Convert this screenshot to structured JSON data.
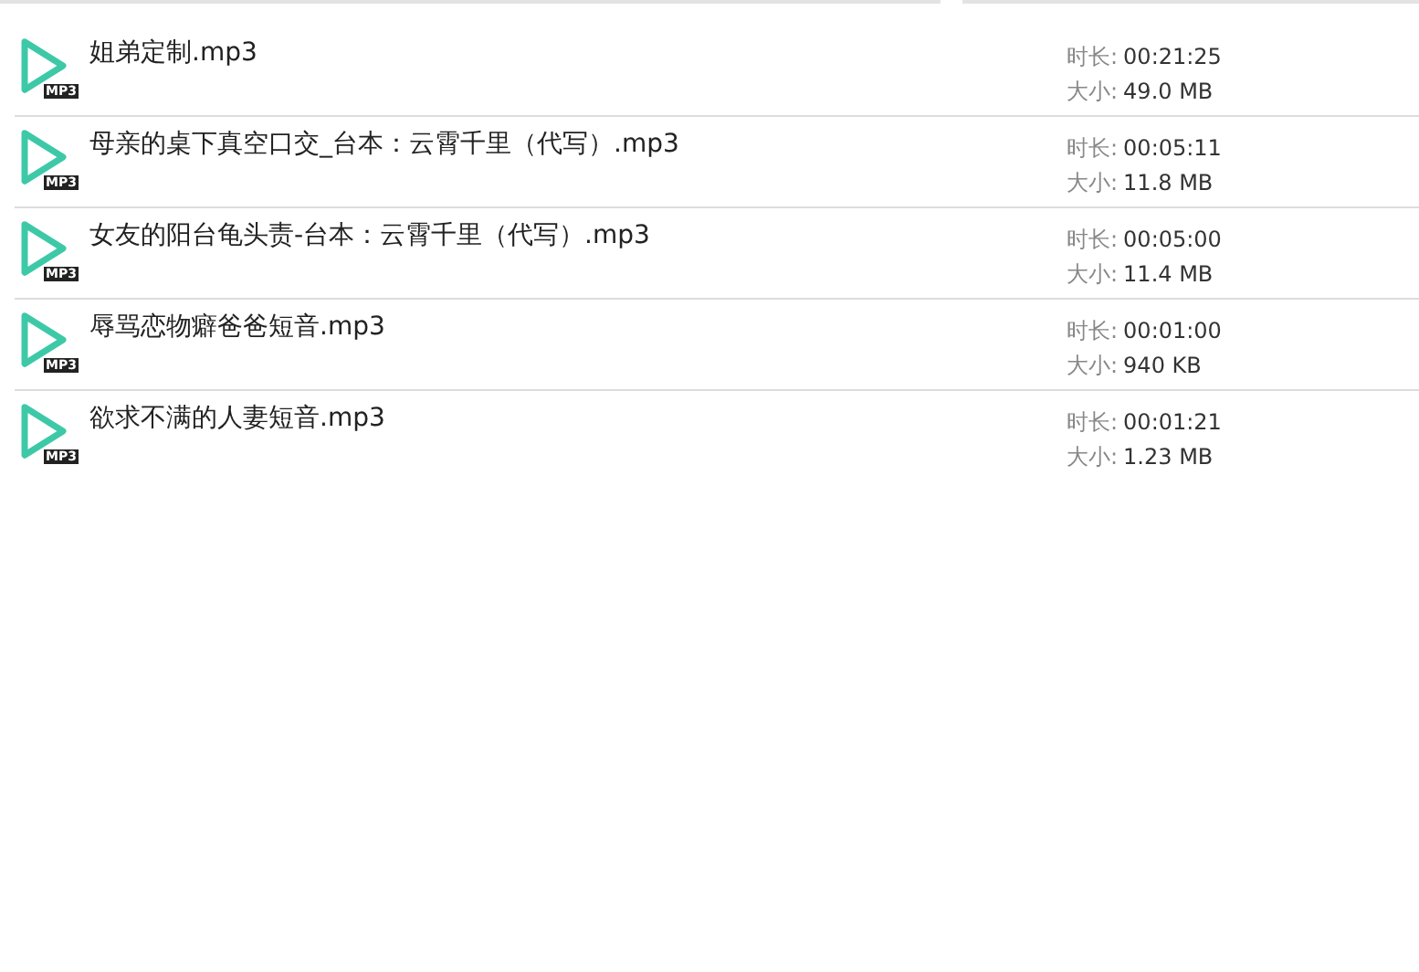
{
  "files": [
    {
      "name": "姐弟定制.mp3",
      "badge": "MP3",
      "duration_label": "时长:",
      "duration": "00:21:25",
      "size_label": "大小:",
      "size": "49.0 MB"
    },
    {
      "name": "母亲的桌下真空口交_台本：云霄千里（代写）.mp3",
      "badge": "MP3",
      "duration_label": "时长:",
      "duration": "00:05:11",
      "size_label": "大小:",
      "size": "11.8 MB"
    },
    {
      "name": "女友的阳台龟头责-台本：云霄千里（代写）.mp3",
      "badge": "MP3",
      "duration_label": "时长:",
      "duration": "00:05:00",
      "size_label": "大小:",
      "size": "11.4 MB"
    },
    {
      "name": "辱骂恋物癖爸爸短音.mp3",
      "badge": "MP3",
      "duration_label": "时长:",
      "duration": "00:01:00",
      "size_label": "大小:",
      "size": "940 KB"
    },
    {
      "name": "欲求不满的人妻短音.mp3",
      "badge": "MP3",
      "duration_label": "时长:",
      "duration": "00:01:21",
      "size_label": "大小:",
      "size": "1.23 MB"
    }
  ]
}
